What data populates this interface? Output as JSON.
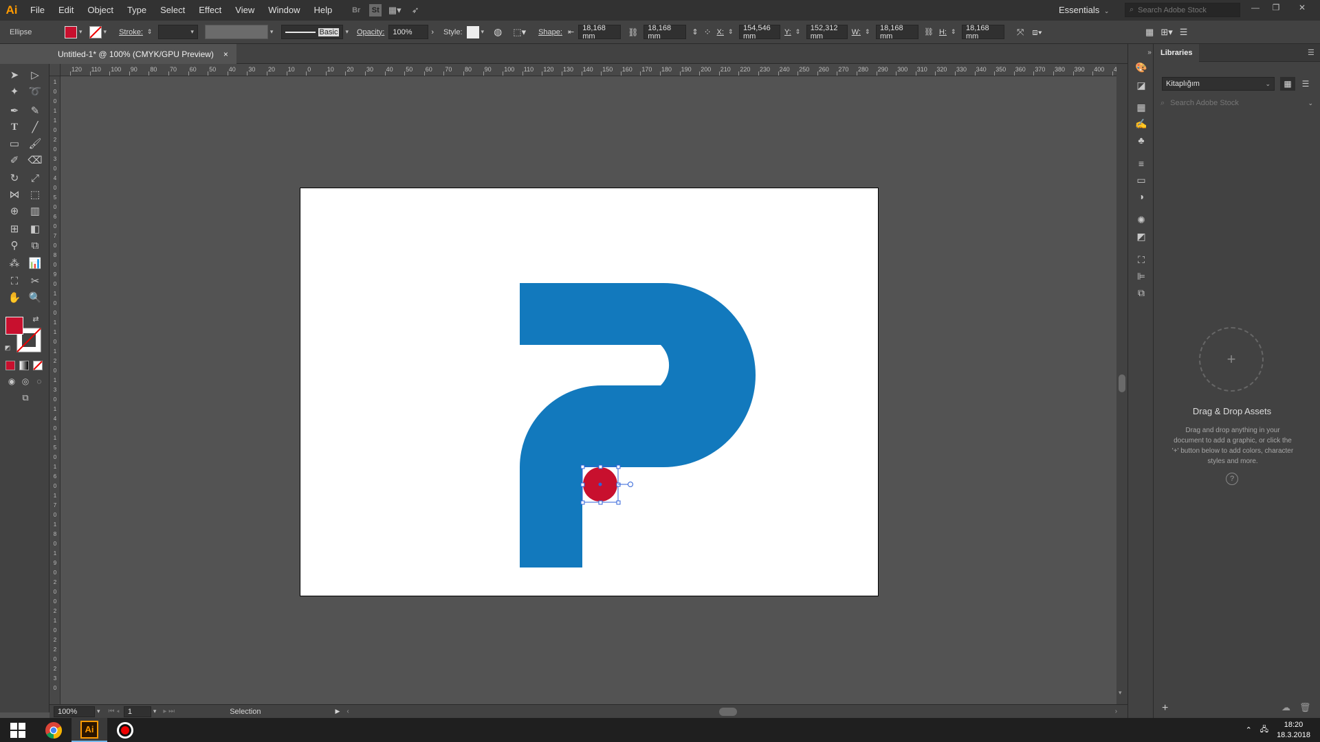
{
  "app": {
    "logo": "Ai"
  },
  "menu": [
    "File",
    "Edit",
    "Object",
    "Type",
    "Select",
    "Effect",
    "View",
    "Window",
    "Help"
  ],
  "menubar_icons": [
    "bridge-icon",
    "stock-icon",
    "arrange-documents-icon",
    "gpu-performance-icon"
  ],
  "workspace": {
    "label": "Essentials",
    "search_placeholder": "Search Adobe Stock"
  },
  "control": {
    "object_type": "Ellipse",
    "fill_color": "#c8102e",
    "stroke_label": "Stroke:",
    "brush_label": "Basic",
    "opacity_label": "Opacity:",
    "opacity_value": "100%",
    "style_label": "Style:",
    "shape_label": "Shape:",
    "shape_width": "18,168 mm",
    "shape_height": "18,168 mm",
    "x_label": "X:",
    "x_value": "154,546 mm",
    "y_label": "Y:",
    "y_value": "152,312 mm",
    "w_label": "W:",
    "w_value": "18,168 mm",
    "h_label": "H:",
    "h_value": "18,168 mm"
  },
  "document": {
    "tab_title": "Untitled-1* @ 100% (CMYK/GPU Preview)",
    "close": "×"
  },
  "ruler_h": [
    "120",
    "110",
    "100",
    "90",
    "80",
    "70",
    "60",
    "50",
    "40",
    "30",
    "20",
    "10",
    "0",
    "10",
    "20",
    "30",
    "40",
    "50",
    "60",
    "70",
    "80",
    "90",
    "100",
    "110",
    "120",
    "130",
    "140",
    "150",
    "160",
    "170",
    "180",
    "190",
    "200",
    "210",
    "220",
    "230",
    "240",
    "250",
    "260",
    "270",
    "280",
    "290",
    "300",
    "310",
    "320",
    "330",
    "340",
    "350",
    "360",
    "370",
    "380",
    "390",
    "400",
    "410"
  ],
  "ruler_v": [
    "1",
    "0",
    "0",
    "1",
    "1",
    "0",
    "2",
    "0",
    "3",
    "0",
    "4",
    "0",
    "5",
    "0",
    "6",
    "0",
    "7",
    "0",
    "8",
    "0",
    "9",
    "0",
    "1",
    "0",
    "0",
    "1",
    "1",
    "0",
    "1",
    "2",
    "0",
    "1",
    "3",
    "0",
    "1",
    "4",
    "0",
    "1",
    "5",
    "0",
    "1",
    "6",
    "0",
    "1",
    "7",
    "0",
    "1",
    "8",
    "0",
    "1",
    "9",
    "0",
    "2",
    "0",
    "0",
    "2",
    "1",
    "0",
    "2",
    "2",
    "0",
    "2",
    "3",
    "0"
  ],
  "artwork": {
    "p_color": "#1279bd",
    "dot_color": "#c8102e",
    "selection_color": "#2f62d8"
  },
  "colors": {
    "fill": "#c8102e"
  },
  "status": {
    "zoom": "100%",
    "artboard": "1",
    "tool": "Selection"
  },
  "libraries": {
    "tab": "Libraries",
    "library_name": "Kitaplığım",
    "search_placeholder": "Search Adobe Stock",
    "empty_title": "Drag & Drop Assets",
    "empty_text": "Drag and drop anything in your document to add a graphic, or click the '+' button below to add colors, character styles and more."
  },
  "taskbar": {
    "time": "18:20",
    "date": "18.3.2018",
    "apps": [
      "chrome-icon",
      "illustrator-icon",
      "recorder-icon"
    ]
  }
}
